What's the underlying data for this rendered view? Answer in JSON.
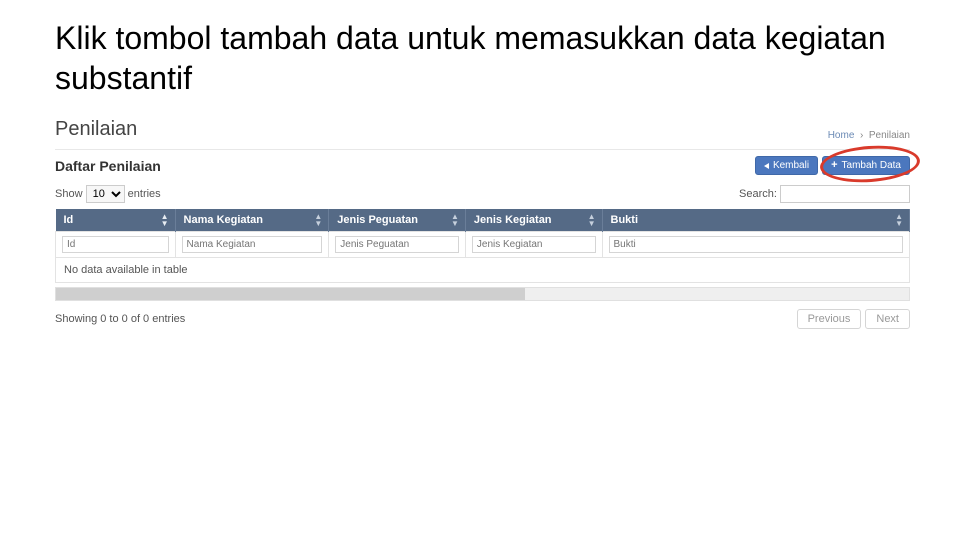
{
  "slide": {
    "title": "Klik tombol tambah data untuk memasukkan data kegiatan substantif"
  },
  "breadcrumb": {
    "home": "Home",
    "current": "Penilaian"
  },
  "page": {
    "title": "Penilaian"
  },
  "panel": {
    "title": "Daftar Penilaian",
    "back_label": "Kembali",
    "add_label": "Tambah Data"
  },
  "controls": {
    "show_label_pre": "Show",
    "show_value": "10",
    "show_label_post": "entries",
    "search_label": "Search:",
    "search_value": ""
  },
  "table": {
    "headers": [
      "Id",
      "Nama Kegiatan",
      "Jenis Peguatan",
      "Jenis Kegiatan",
      "Bukti"
    ],
    "filter_placeholders": [
      "Id",
      "Nama Kegiatan",
      "Jenis Peguatan",
      "Jenis Kegiatan",
      "Bukti"
    ],
    "empty": "No data available in table"
  },
  "footer": {
    "info": "Showing 0 to 0 of 0 entries",
    "previous": "Previous",
    "next": "Next"
  }
}
